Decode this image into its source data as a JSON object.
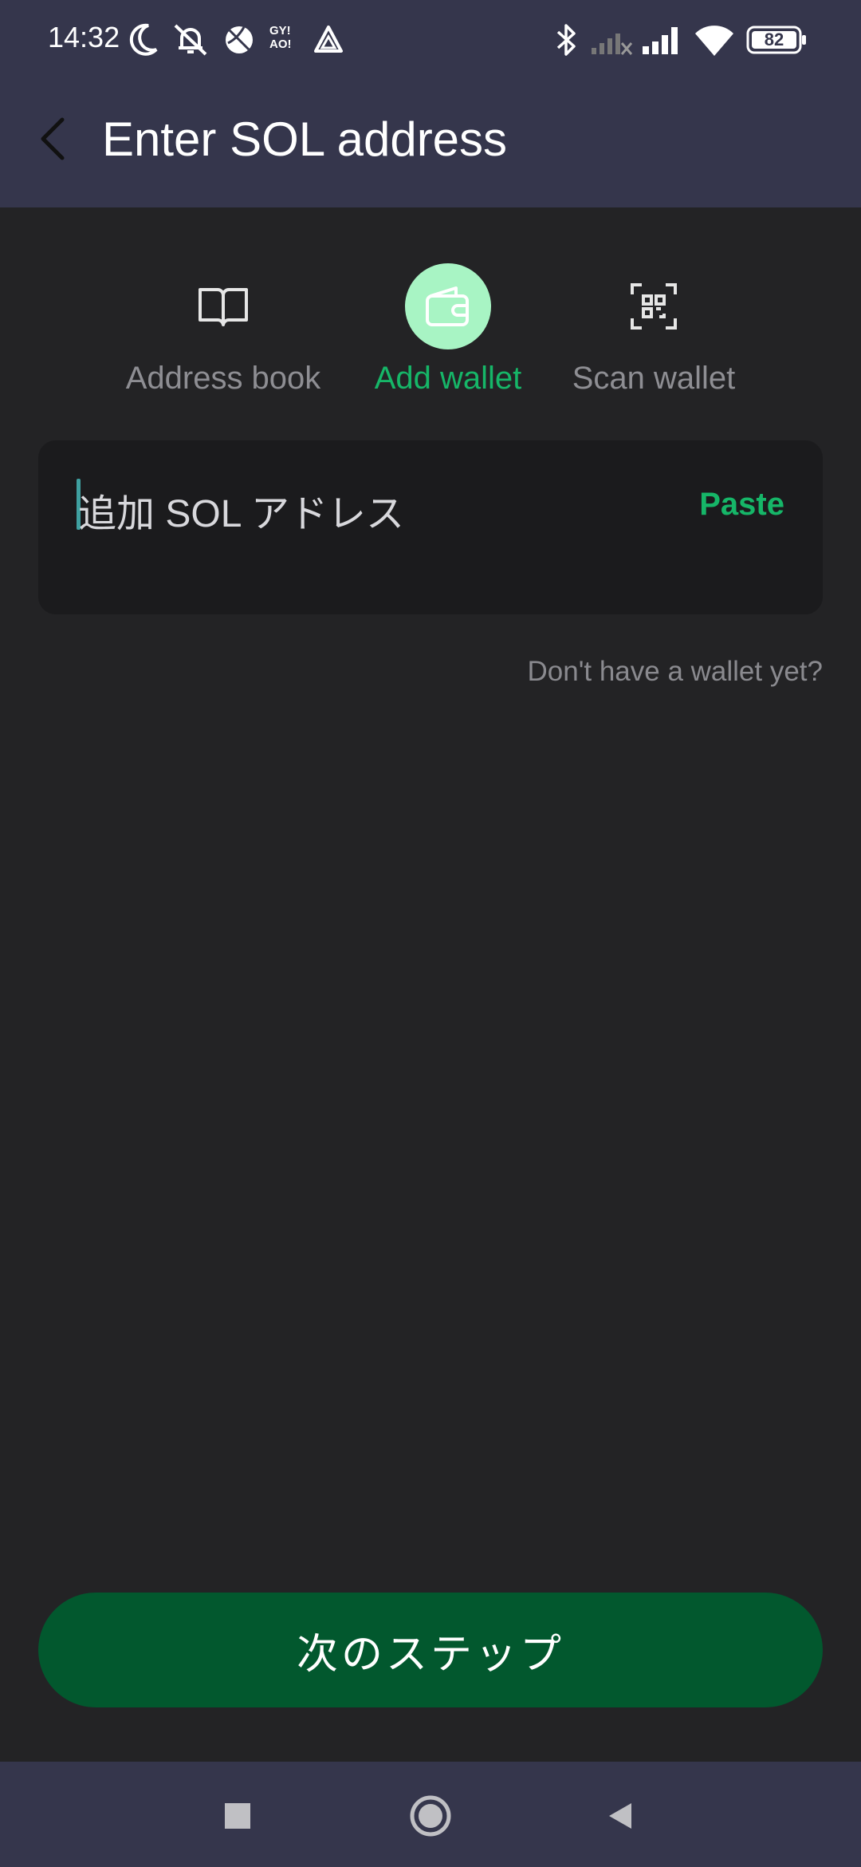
{
  "status_bar": {
    "time": "14:32",
    "battery_level": "82",
    "icons_left": [
      "moon-icon",
      "bell-off-icon",
      "ball-icon",
      "gy-ao-icon",
      "triangle-app-icon"
    ],
    "icons_right": [
      "bluetooth-icon",
      "signal-no-sim-icon",
      "signal-icon",
      "wifi-icon",
      "battery-icon"
    ],
    "gy_ao_text": "GY! AO!"
  },
  "header": {
    "title": "Enter SOL address",
    "back_icon": "chevron-left-icon"
  },
  "tabs": [
    {
      "label": "Address book",
      "icon": "book-icon",
      "active": false
    },
    {
      "label": "Add wallet",
      "icon": "wallet-icon",
      "active": true
    },
    {
      "label": "Scan wallet",
      "icon": "qr-scan-icon",
      "active": false
    }
  ],
  "address_input": {
    "placeholder": "追加 SOL アドレス",
    "paste_label": "Paste"
  },
  "no_wallet_link": "Don't have a wallet yet?",
  "next_button": "次のステップ",
  "nav": [
    "recents-square-icon",
    "home-circle-icon",
    "back-triangle-icon"
  ],
  "colors": {
    "header_bg": "#35364c",
    "page_bg": "#232325",
    "accent_green": "#16b668",
    "button_green": "#02582e",
    "active_tab_circle": "#a8f4c4"
  }
}
